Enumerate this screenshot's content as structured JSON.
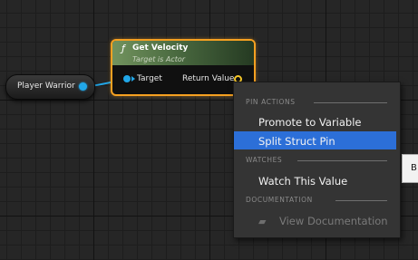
{
  "graph": {
    "variable_node": {
      "label": "Player Warrior"
    },
    "function_node": {
      "icon": "function-f-icon",
      "icon_glyph": "ƒ",
      "title": "Get Velocity",
      "subtitle": "Target is Actor",
      "input_pin": {
        "label": "Target",
        "color": "#21a7e8"
      },
      "output_pin": {
        "label": "Return Value",
        "color": "#f7c82a"
      },
      "header_color": "#72935e",
      "selection_color": "#f5a021"
    }
  },
  "context_menu": {
    "sections": [
      {
        "label": "PIN ACTIONS"
      },
      {
        "label": "WATCHES"
      },
      {
        "label": "DOCUMENTATION"
      }
    ],
    "items": [
      {
        "label": "Promote to Variable",
        "selected": false,
        "enabled": true
      },
      {
        "label": "Split Struct Pin",
        "selected": true,
        "enabled": true
      },
      {
        "label": "Watch This Value",
        "selected": false,
        "enabled": true
      },
      {
        "label": "View Documentation",
        "selected": false,
        "enabled": false,
        "icon": "book-icon"
      }
    ],
    "highlight_color": "#2c6fd8"
  },
  "tooltip": {
    "text": "B"
  }
}
